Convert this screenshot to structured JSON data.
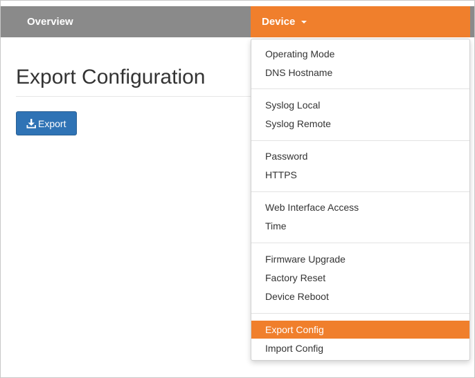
{
  "nav": {
    "overview_label": "Overview",
    "device_label": "Device"
  },
  "page": {
    "title": "Export Configuration",
    "export_button_label": "Export"
  },
  "dropdown": {
    "items": [
      {
        "label": "Operating Mode"
      },
      {
        "label": "DNS Hostname"
      },
      {
        "label": "Syslog Local"
      },
      {
        "label": "Syslog Remote"
      },
      {
        "label": "Password"
      },
      {
        "label": "HTTPS"
      },
      {
        "label": "Web Interface Access"
      },
      {
        "label": "Time"
      },
      {
        "label": "Firmware Upgrade"
      },
      {
        "label": "Factory Reset"
      },
      {
        "label": "Device Reboot"
      },
      {
        "label": "Export Config",
        "active": true
      },
      {
        "label": "Import Config"
      }
    ]
  },
  "colors": {
    "accent": "#f07f2c",
    "navbar": "#8a8a8a",
    "primary_button": "#2f73b5"
  },
  "icons": {
    "export_button_icon": "download-icon",
    "device_menu_icon": "caret-down-icon"
  }
}
